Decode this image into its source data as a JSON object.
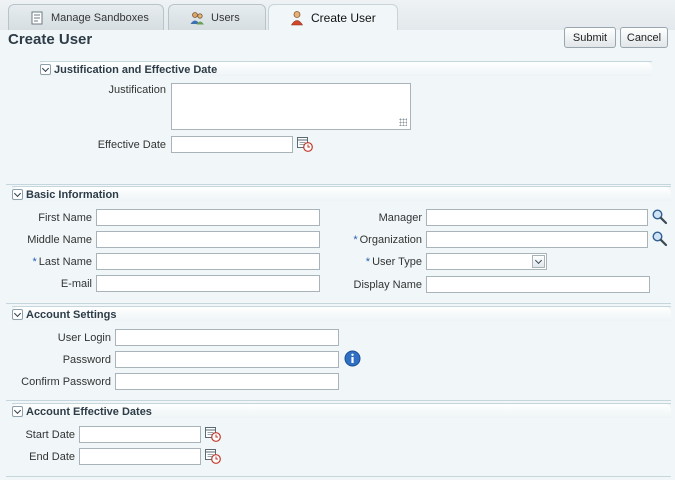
{
  "tabs": [
    {
      "label": "Manage Sandboxes",
      "icon": "sandbox-icon"
    },
    {
      "label": "Users",
      "icon": "users-icon"
    },
    {
      "label": "Create User",
      "icon": "user-icon"
    }
  ],
  "page": {
    "title": "Create User"
  },
  "actions": {
    "submit": "Submit",
    "cancel": "Cancel"
  },
  "justification_section": {
    "title": "Justification and Effective Date",
    "justification_label": "Justification",
    "effective_date_label": "Effective Date",
    "justification_value": "",
    "effective_date_value": ""
  },
  "basic_section": {
    "title": "Basic Information",
    "first_name_label": "First Name",
    "middle_name_label": "Middle Name",
    "last_name_label": "Last Name",
    "email_label": "E-mail",
    "manager_label": "Manager",
    "organization_label": "Organization",
    "user_type_label": "User Type",
    "display_name_label": "Display Name",
    "required_marker": "*",
    "first_name_value": "",
    "middle_name_value": "",
    "last_name_value": "",
    "email_value": "",
    "manager_value": "",
    "organization_value": "",
    "user_type_value": "",
    "display_name_value": ""
  },
  "account_section": {
    "title": "Account Settings",
    "user_login_label": "User Login",
    "password_label": "Password",
    "confirm_password_label": "Confirm Password",
    "user_login_value": "",
    "password_value": "",
    "confirm_password_value": ""
  },
  "dates_section": {
    "title": "Account Effective Dates",
    "start_date_label": "Start Date",
    "end_date_label": "End Date",
    "start_date_value": "",
    "end_date_value": ""
  },
  "colors": {
    "background": "#f1f7f9",
    "required_marker": "#2a5db0",
    "heading": "#2d3c47",
    "info_icon": "#2f6fc4"
  }
}
